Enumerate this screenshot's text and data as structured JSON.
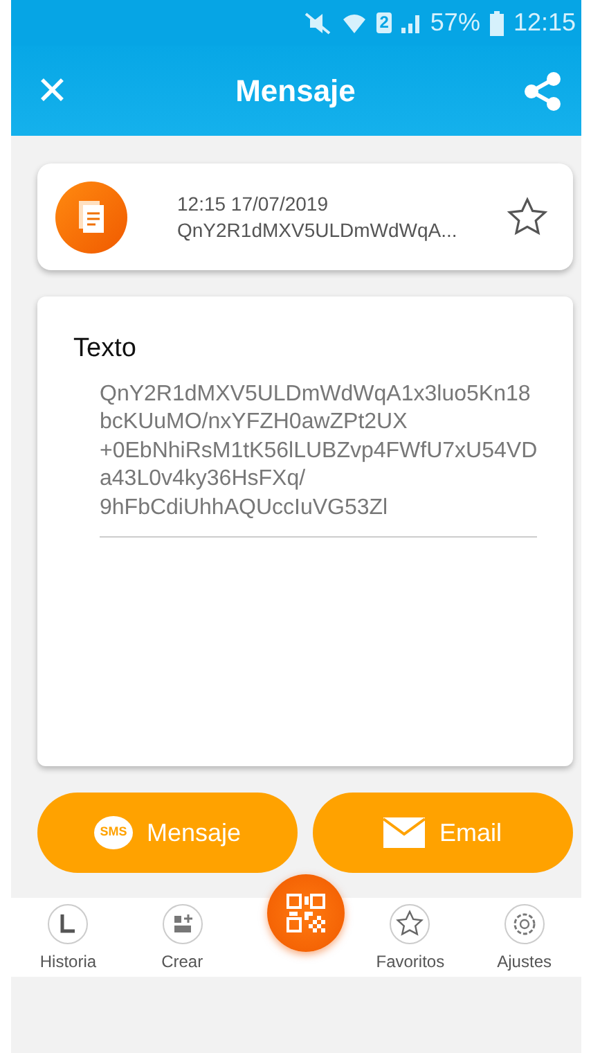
{
  "status_bar": {
    "sim": "2",
    "battery": "57%",
    "time": "12:15"
  },
  "app_bar": {
    "close": "✕",
    "title": "Mensaje"
  },
  "entry": {
    "datetime": "12:15 17/07/2019",
    "preview": "QnY2R1dMXV5ULDmWdWqA...",
    "favorite": false
  },
  "content": {
    "heading": "Texto",
    "lines": [
      "QnY2R1dMXV5ULDmWdWqA1x3luo5Kn18",
      "bcKUuMO/nxYFZH0awZPt2UX",
      "+0EbNhiRsM1tK56lLUBZvp4FWfU7xU54VD",
      "a43L0v4ky36HsFXq/",
      "9hFbCdiUhhAQUccIuVG53Zl"
    ]
  },
  "actions": [
    {
      "kind": "sms",
      "badge": "SMS",
      "label": "Mensaje"
    },
    {
      "kind": "email",
      "label": "Email"
    }
  ],
  "nav": [
    {
      "kind": "history",
      "label": "Historia",
      "selected": false
    },
    {
      "kind": "create",
      "label": "Crear",
      "selected": false
    },
    {
      "kind": "scan",
      "selected": true
    },
    {
      "kind": "favorites",
      "label": "Favoritos",
      "selected": false
    },
    {
      "kind": "settings",
      "label": "Ajustes",
      "selected": false
    }
  ]
}
